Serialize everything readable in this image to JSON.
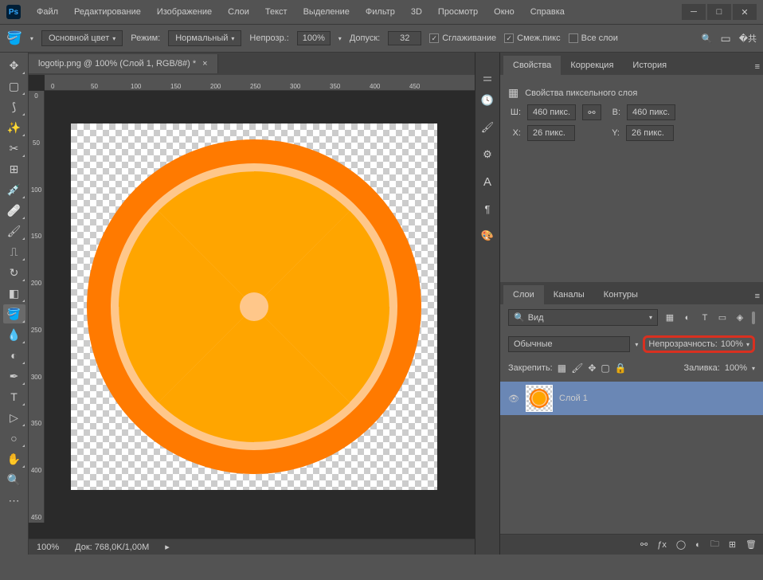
{
  "menu": {
    "file": "Файл",
    "edit": "Редактирование",
    "image": "Изображение",
    "layer": "Слои",
    "type": "Текст",
    "select": "Выделение",
    "filter": "Фильтр",
    "threed": "3D",
    "view": "Просмотр",
    "window": "Окно",
    "help": "Справка"
  },
  "optbar": {
    "foreground": "Основной цвет",
    "mode_label": "Режим:",
    "mode_value": "Нормальный",
    "opacity_label": "Непрозр.:",
    "opacity_value": "100%",
    "tolerance_label": "Допуск:",
    "tolerance_value": "32",
    "antialias": "Сглаживание",
    "contiguous": "Смеж.пикс",
    "alllayers": "Все слои"
  },
  "tab": {
    "title": "logotip.png @ 100% (Слой 1, RGB/8#) *"
  },
  "ruler_h": [
    "0",
    "50",
    "100",
    "150",
    "200",
    "250",
    "300",
    "350",
    "400",
    "450"
  ],
  "ruler_v": [
    "0",
    "5",
    "0",
    "1",
    "0",
    "0",
    "1",
    "5",
    "0",
    "2",
    "0",
    "0",
    "2",
    "5",
    "0",
    "3",
    "0",
    "0",
    "3",
    "5",
    "0",
    "4",
    "0",
    "0",
    "4",
    "5",
    "0"
  ],
  "status": {
    "zoom": "100%",
    "docsize": "Док: 768,0K/1,00M"
  },
  "panels": {
    "props_tab": "Свойства",
    "adjust_tab": "Коррекция",
    "history_tab": "История",
    "props_title": "Свойства пиксельного слоя",
    "w_label": "Ш:",
    "w_val": "460 пикс.",
    "h_label": "В:",
    "h_val": "460 пикс.",
    "x_label": "X:",
    "x_val": "26 пикс.",
    "y_label": "Y:",
    "y_val": "26 пикс.",
    "layers_tab": "Слои",
    "channels_tab": "Каналы",
    "paths_tab": "Контуры",
    "search": "Вид",
    "blend": "Обычные",
    "opacity_label": "Непрозрачность:",
    "opacity_val": "100%",
    "lock_label": "Закрепить:",
    "fill_label": "Заливка:",
    "fill_val": "100%",
    "layer1": "Слой 1"
  }
}
